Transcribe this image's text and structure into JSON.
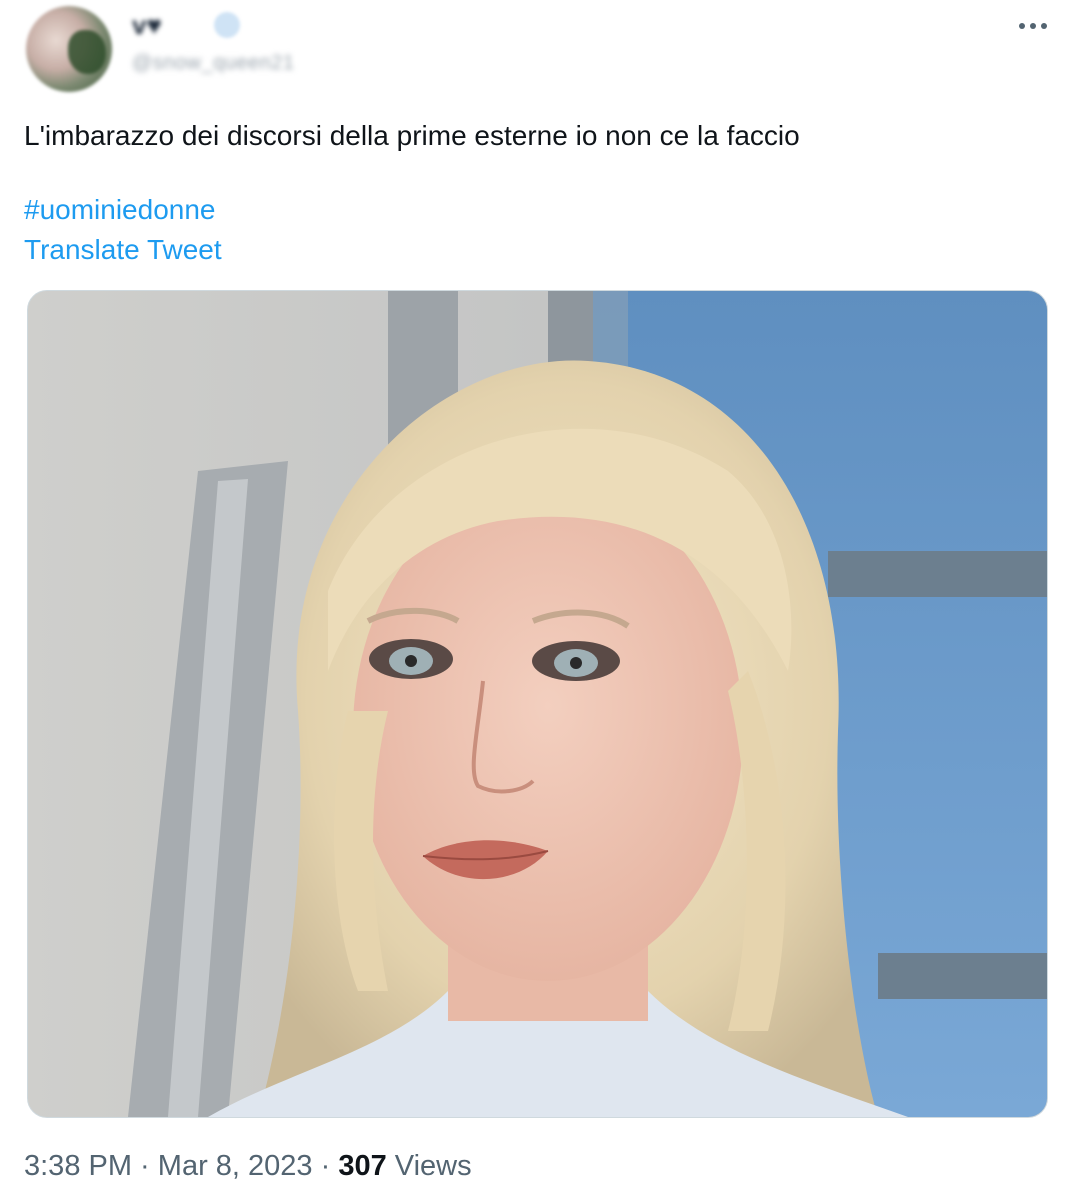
{
  "author": {
    "display_name": "v♥",
    "handle": "@snow_queen21",
    "avatar_icon": "profile-avatar",
    "verified_icon": "verified-badge-icon"
  },
  "more_icon": "more-options-icon",
  "tweet": {
    "text": "L'imbarazzo dei discorsi della prime esterne io non ce la faccio",
    "hashtag": "#uominiedonne",
    "translate_label": "Translate Tweet"
  },
  "media": {
    "type": "photo"
  },
  "meta": {
    "time": "3:38 PM",
    "sep1": " · ",
    "date": "Mar 8, 2023",
    "sep2": " · ",
    "views_count": "307",
    "views_label": " Views"
  },
  "colors": {
    "link": "#1d9bf0",
    "text": "#0f1419",
    "secondary": "#536471"
  }
}
